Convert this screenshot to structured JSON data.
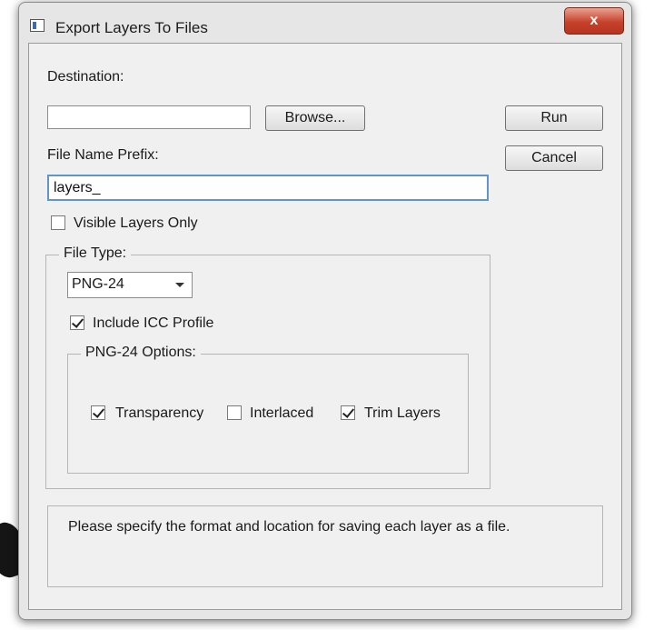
{
  "window": {
    "title": "Export Layers To Files",
    "close_label": "x"
  },
  "destination": {
    "label": "Destination:",
    "value": "",
    "browse_label": "Browse..."
  },
  "actions": {
    "run_label": "Run",
    "cancel_label": "Cancel"
  },
  "prefix": {
    "label": "File Name Prefix:",
    "value": "layers_"
  },
  "visible_only": {
    "label": "Visible Layers Only",
    "checked": false
  },
  "file_type": {
    "legend": "File Type:",
    "selected": "PNG-24",
    "icc": {
      "label": "Include ICC Profile",
      "checked": true
    }
  },
  "png_options": {
    "legend": "PNG-24 Options:",
    "transparency": {
      "label": "Transparency",
      "checked": true
    },
    "interlaced": {
      "label": "Interlaced",
      "checked": false
    },
    "trim": {
      "label": "Trim Layers",
      "checked": true
    }
  },
  "status": {
    "message": "Please specify the format and location for saving each layer as a file."
  }
}
